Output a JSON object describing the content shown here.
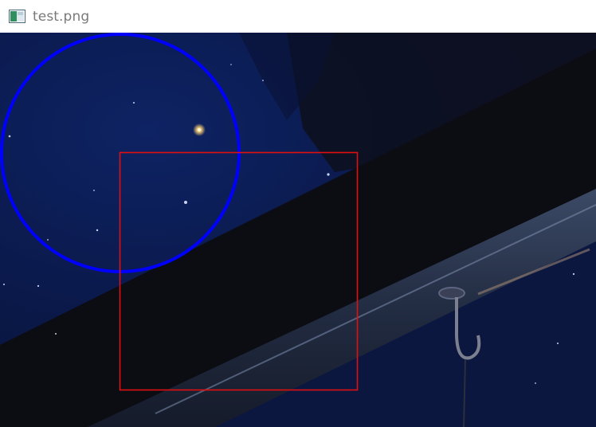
{
  "window": {
    "title": "test.png",
    "icon": "image-file-icon"
  },
  "image": {
    "description_colors": {
      "sky": "#0c1a4a",
      "sky_deep": "#08123a",
      "beam": "#0c0d13",
      "rail": "#2a3650",
      "rail_highlight": "#7d8fb0"
    },
    "overlays": {
      "circle": {
        "stroke": "#0000ff"
      },
      "rectangle": {
        "stroke": "#e01010"
      }
    }
  }
}
